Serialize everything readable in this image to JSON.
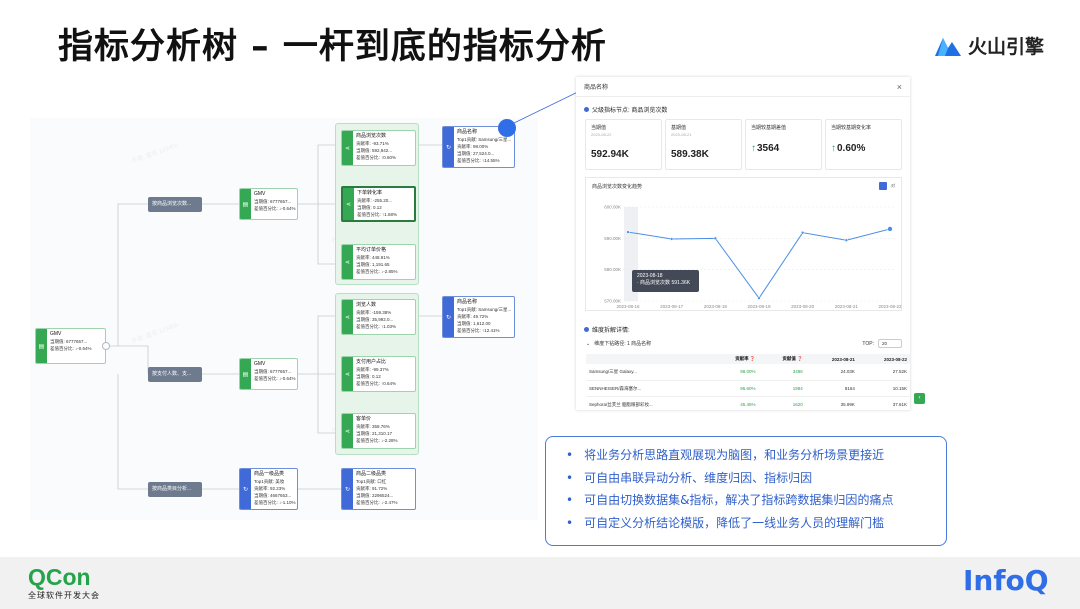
{
  "slide": {
    "title": "指标分析树 – 一杆到底的指标分析",
    "brand": "火山引擎"
  },
  "watermark": "作者: 匿名 123456",
  "tree": {
    "root": {
      "name": "GMV",
      "l2": "当期值: 6777657...",
      "l3": "差值百分比: ↓-0.64%"
    },
    "groups": [
      {
        "label": "按商品浏览次数..."
      },
      {
        "label": "按支付人数、支..."
      },
      {
        "label": "按商品类目分析..."
      }
    ],
    "gmv1": {
      "name": "GMV",
      "l2": "当期值: 6777657...",
      "l3": "差值百分比: ↓-0.64%"
    },
    "gmv2": {
      "name": "GMV",
      "l2": "当期值: 6777657...",
      "l3": "差值百分比: ↓-0.64%"
    },
    "cat1": {
      "name": "商品一级品类",
      "l2": "Top1贡献: 美妆",
      "l3": "贡献率: 92.23%",
      "l4": "当期值: 4667653...",
      "l5": "差值百分比: ↓-1.10%"
    },
    "cat2": {
      "name": "商品二级品类",
      "l2": "Top1贡献: 口红",
      "l3": "贡献率: 91.72%",
      "l4": "当期值: 2296524...",
      "l5": "差值百分比: ↓-2.47%"
    },
    "g1": [
      {
        "name": "商品浏览次数",
        "l2": "贡献率: -93.71%",
        "l3": "当期值: 592,942...",
        "l4": "差值百分比: ↑0.60%"
      },
      {
        "name": "下单转化率",
        "l2": "贡献率: -255.20...",
        "l3": "当期值: 0.12",
        "l4": "差值百分比: ↑1.68%"
      },
      {
        "name": "平均订单价格",
        "l2": "贡献率: 448.91%",
        "l3": "当期值: 1,191.65",
        "l4": "差值百分比: ↓-2.85%"
      }
    ],
    "g2": [
      {
        "name": "浏览人数",
        "l2": "贡献率: -159.38%",
        "l3": "当期值: 35,992.0...",
        "l4": "差值百分比: ↑1.03%"
      },
      {
        "name": "支付用户占比",
        "l2": "贡献率: -99.37%",
        "l3": "当期值: 0.12",
        "l4": "差值百分比: ↑0.64%"
      },
      {
        "name": "客单价",
        "l2": "贡献率: 358.76%",
        "l3": "当期值: 21,310.17",
        "l4": "差值百分比: ↓-2.28%"
      }
    ],
    "p1": {
      "name": "商品名称",
      "l2": "Top1贡献: Samsung/三星...",
      "l3": "贡献率: 98.00%",
      "l4": "当期值: 27,524.0...",
      "l5": "差值百分比: ↑14.55%"
    },
    "p2": {
      "name": "商品名称",
      "l2": "Top1贡献: Samsung/三星...",
      "l3": "贡献率: 49.72%",
      "l4": "当期值: 1,612.00",
      "l5": "差值百分比: ↑12.41%"
    }
  },
  "panel": {
    "header": "商品名称",
    "close": "×",
    "parent_label": "父级指标节点: 商品浏览次数",
    "metrics": [
      {
        "label": "当期值",
        "date": "2023-08-22",
        "value": "592.94K",
        "up": false
      },
      {
        "label": "基期值",
        "date": "2023-08-21",
        "value": "589.38K",
        "up": false
      },
      {
        "label": "当期较基期差值",
        "date": "",
        "value": "3564",
        "up": true
      },
      {
        "label": "当期较基期变化率",
        "date": "",
        "value": "0.60%",
        "up": true
      }
    ],
    "chart_title": "商品浏览次数变化趋势",
    "chart_check_label": "对",
    "tooltip": {
      "date": "2023-08-18",
      "line": "· 商品浏览次数   591.36K"
    },
    "dim_title": "维度拆解详情:",
    "drill_label": "维度下钻路径: 1  商品名称",
    "top_label": "TOP:",
    "top_value": "20",
    "table": {
      "headers": [
        "",
        "贡献率 ❓",
        "贡献值 ❓",
        "2023-08-21",
        "2023-08-22"
      ],
      "rows": [
        [
          "Samsung/三星 Galaxy...",
          "98.00%",
          "3496",
          "24.03K",
          "27.52K"
        ],
        [
          "SENNHEISER/森海塞尔...",
          "95.60%",
          "1994",
          "8164",
          "10.15K"
        ],
        [
          "Sephora/丝芙兰 胭脂眼部彩妆...",
          "45.45%",
          "1620",
          "35.99K",
          "37.61K"
        ]
      ]
    }
  },
  "chart_data": {
    "type": "line",
    "title": "商品浏览次数变化趋势",
    "x": [
      "2023-08-16",
      "2023-08-17",
      "2023-08-18",
      "2023-08-19",
      "2023-08-20",
      "2023-08-21",
      "2023-08-22"
    ],
    "series": [
      {
        "name": "商品浏览次数",
        "values": [
          592000,
          589800,
          590000,
          570900,
          591800,
          589400,
          593000
        ]
      }
    ],
    "ylim": [
      570000,
      600000
    ],
    "yticks": [
      "600.00K",
      "590.00K",
      "580.00K",
      "570.00K"
    ],
    "ytick_values": [
      600000,
      590000,
      580000,
      570000
    ],
    "grid": true,
    "line_color": "#4a8ee8"
  },
  "info_box": {
    "bullets": [
      "将业务分析思路直观展现为脑图，和业务分析场景更接近",
      "可自由串联异动分析、维度归因、指标归因",
      "可自由切换数据集&指标，解决了指标跨数据集归因的痛点",
      "可自定义分析结论模版，降低了一线业务人员的理解门槛"
    ]
  },
  "footer": {
    "qcon": "QCon",
    "qcon_sub": "全球软件开发大会",
    "infoq": "InfoQ"
  },
  "colors": {
    "accent_blue": "#2f6ee6",
    "accent_green": "#34a853",
    "qcon_green": "#24a34a"
  }
}
